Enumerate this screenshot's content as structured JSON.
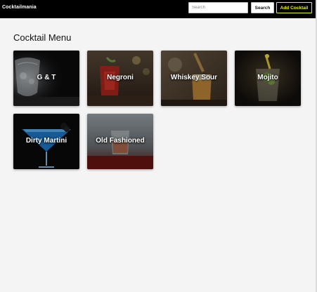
{
  "navbar": {
    "brand": "Cocktailmania",
    "search_placeholder": "Search",
    "search_button": "Search",
    "add_button": "Add Cocktail"
  },
  "main": {
    "title": "Cocktail Menu",
    "cards": [
      {
        "label": "G & T"
      },
      {
        "label": "Negroni"
      },
      {
        "label": "Whiskey Sour"
      },
      {
        "label": "Mojito"
      },
      {
        "label": "Dirty Martini"
      },
      {
        "label": "Old Fashioned"
      }
    ]
  },
  "colors": {
    "navbar_bg": "#000000",
    "accent": "#e6f01c",
    "page_bg": "#f4f4f4"
  }
}
